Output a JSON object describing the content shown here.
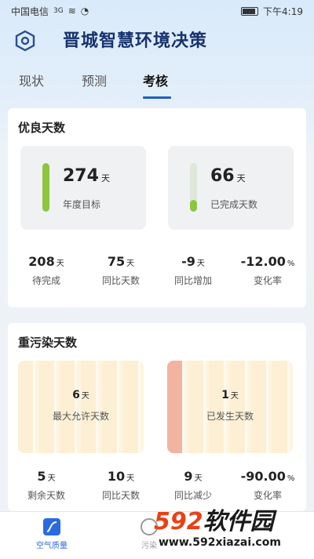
{
  "status_bar": {
    "carrier": "中国电信",
    "signal": "3G",
    "time": "下午4:19"
  },
  "app": {
    "title": "晋城智慧环境决策"
  },
  "tabs": [
    {
      "label": "现状"
    },
    {
      "label": "预测"
    },
    {
      "label": "考核"
    }
  ],
  "good_days": {
    "title": "优良天数",
    "target": {
      "value": "274",
      "unit": "天",
      "label": "年度目标",
      "fill": 1.0
    },
    "completed": {
      "value": "66",
      "unit": "天",
      "label": "已完成天数",
      "fill": 0.24
    },
    "stats": [
      {
        "value": "208",
        "unit": "天",
        "label": "待完成"
      },
      {
        "value": "75",
        "unit": "天",
        "label": "同比天数"
      },
      {
        "value": "-9",
        "unit": "天",
        "label": "同比增加"
      },
      {
        "value": "-12.00",
        "unit": "%",
        "label": "变化率"
      }
    ]
  },
  "heavy_pollution_days": {
    "title": "重污染天数",
    "max_allowed": {
      "value": "6",
      "unit": "天",
      "label": "最大允许天数",
      "filled_stripes": 0
    },
    "occurred": {
      "value": "1",
      "unit": "天",
      "label": "已发生天数",
      "filled_stripes": 1
    },
    "stats": [
      {
        "value": "5",
        "unit": "天",
        "label": "剩余天数"
      },
      {
        "value": "10",
        "unit": "天",
        "label": "同比天数"
      },
      {
        "value": "9",
        "unit": "天",
        "label": "同比减少"
      },
      {
        "value": "-90.00",
        "unit": "%",
        "label": "变化率"
      }
    ]
  },
  "bottom_nav": [
    {
      "label": "空气质量",
      "active": true
    },
    {
      "label": "污染",
      "active": false
    }
  ],
  "watermark": {
    "logo_num": "592",
    "logo_text": "软件园",
    "url": "www.592xiazai.com"
  },
  "colors": {
    "accent": "#1f5fbf",
    "green_bar": "#8cc63f",
    "pollution_fill": "#f3b3a1",
    "stripe_bg": "#fcefd4"
  }
}
